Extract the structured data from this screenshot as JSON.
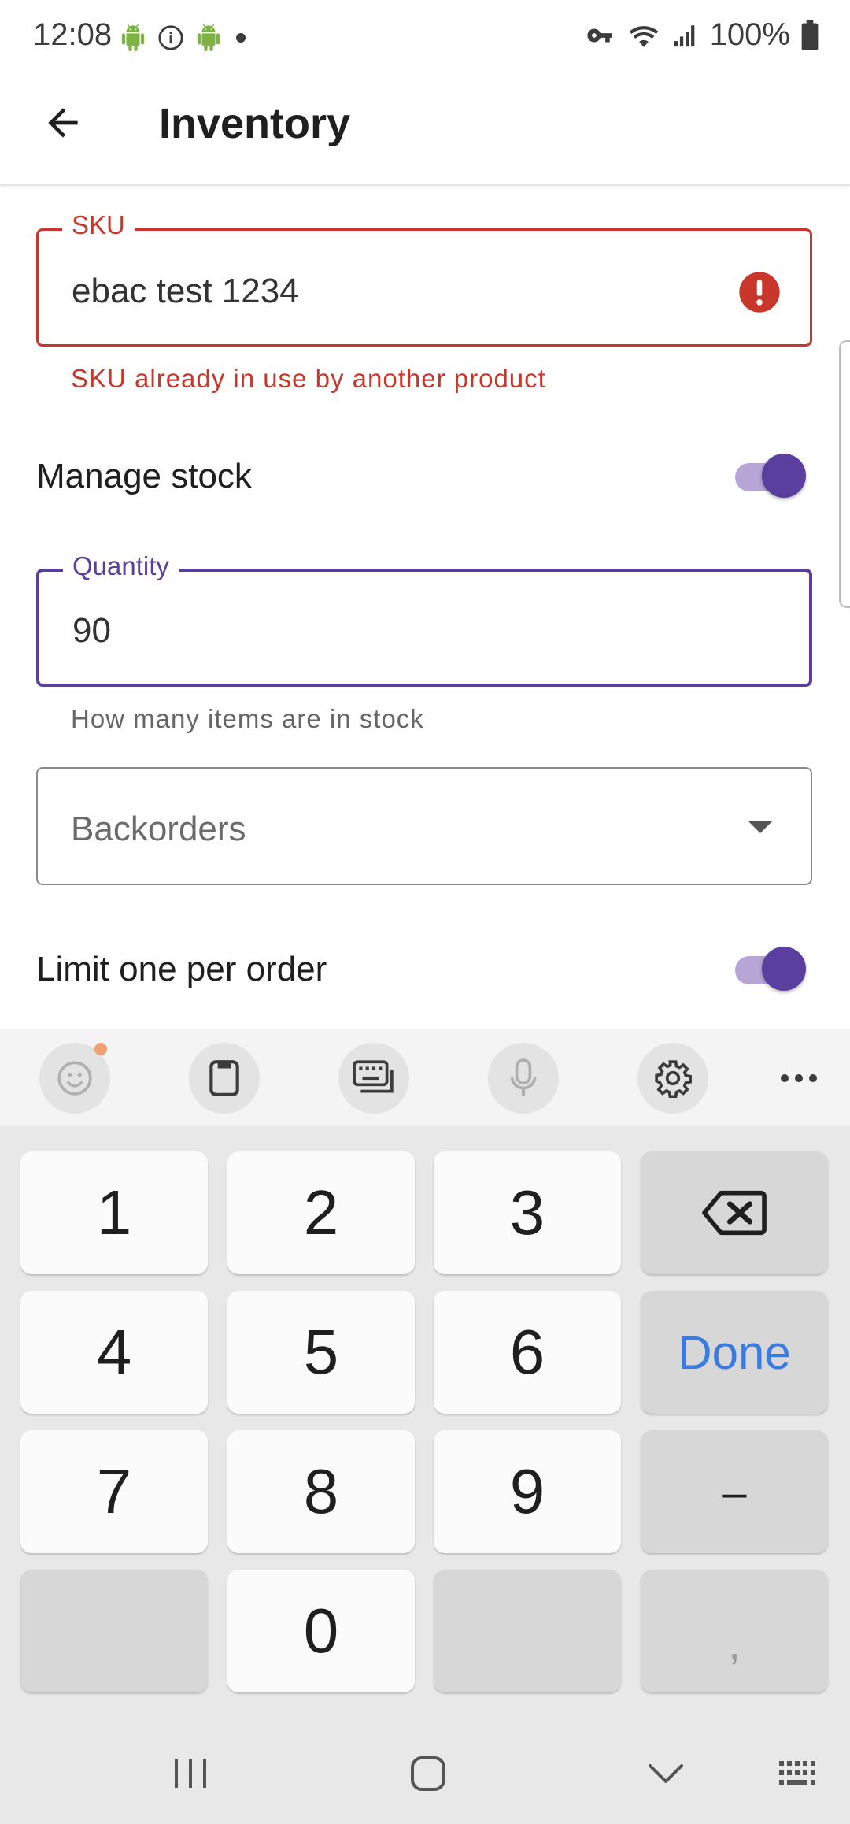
{
  "status_bar": {
    "time": "12:08",
    "battery": "100%",
    "icons": [
      "android-icon",
      "info-icon",
      "android-icon",
      "dot-icon",
      "vpn-key-icon",
      "wifi-icon",
      "signal-icon",
      "battery-icon"
    ]
  },
  "app_bar": {
    "title": "Inventory",
    "back_icon": "arrow-back-icon"
  },
  "form": {
    "sku": {
      "label": "SKU",
      "value": "ebac test 1234",
      "error": "SKU already in use by another product",
      "error_icon": "error-icon"
    },
    "manage_stock": {
      "label": "Manage stock",
      "on": true
    },
    "quantity": {
      "label": "Quantity",
      "value": "90",
      "helper": "How many items are in stock"
    },
    "backorders": {
      "placeholder": "Backorders",
      "icon": "dropdown-arrow-icon"
    },
    "limit_one": {
      "label": "Limit one per order",
      "on": true
    }
  },
  "keyboard": {
    "toolbar": [
      "emoji-icon",
      "clipboard-icon",
      "keyboard-mode-icon",
      "mic-icon",
      "settings-icon",
      "more-icon"
    ],
    "keys": {
      "k1": "1",
      "k2": "2",
      "k3": "3",
      "k4": "4",
      "k5": "5",
      "k6": "6",
      "k7": "7",
      "k8": "8",
      "k9": "9",
      "k0": "0",
      "done": "Done",
      "minus": "–",
      "comma": ","
    }
  },
  "nav_bar": {
    "icons": [
      "recents-icon",
      "home-icon",
      "hide-keyboard-icon",
      "keyboard-switch-icon"
    ]
  },
  "colors": {
    "accent": "#5b3f9e",
    "error": "#c9372c",
    "done": "#3b7be0"
  }
}
